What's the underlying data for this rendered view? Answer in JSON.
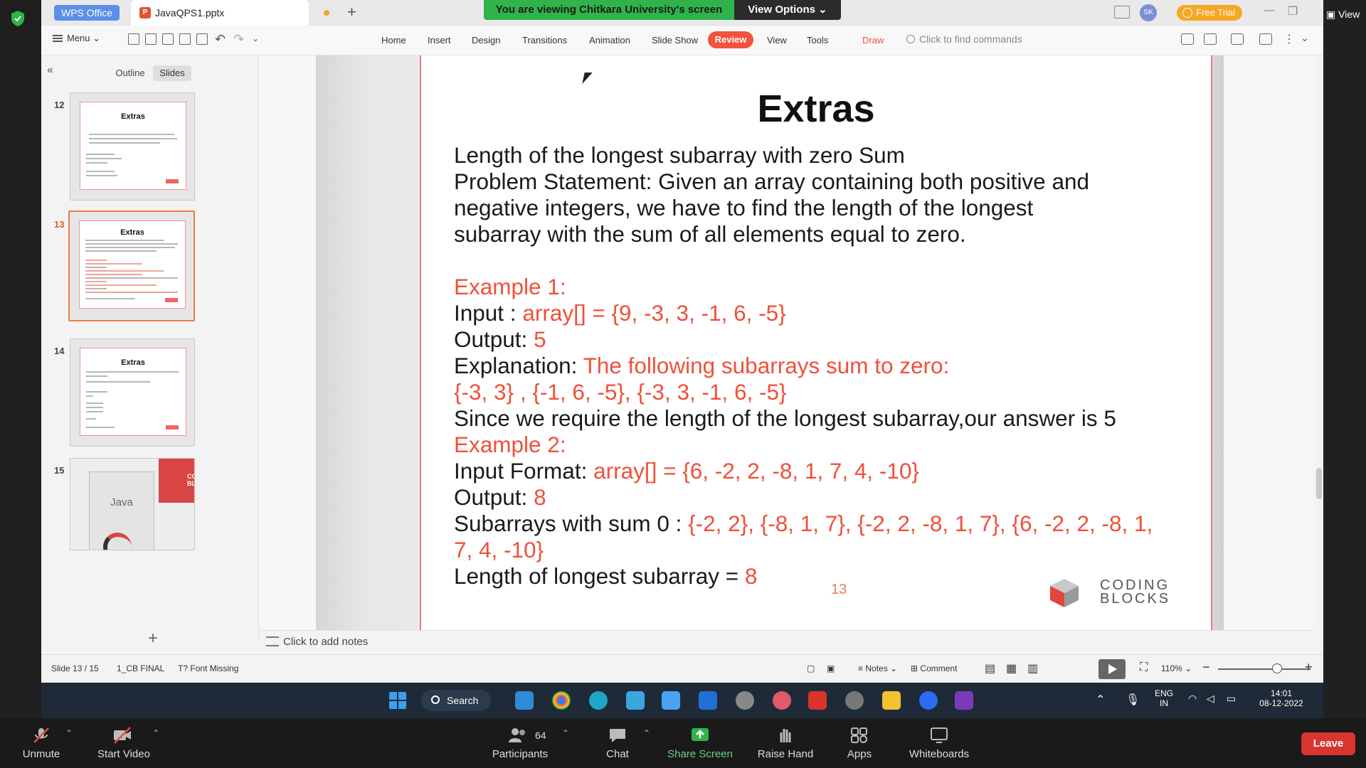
{
  "titlebar": {
    "app_tab": "WPS Office",
    "file_tab": "JavaQPS1.pptx",
    "share_banner": "You are viewing Chitkara University's screen",
    "view_options": "View Options",
    "avatar": "SK",
    "free_trial": "Free Trial",
    "view_right": "View"
  },
  "menubar": {
    "menu": "Menu",
    "tabs": [
      "Home",
      "Insert",
      "Design",
      "Transitions",
      "Animation",
      "Slide Show",
      "Review",
      "View",
      "Tools",
      "Draw"
    ],
    "search_placeholder": "Click to find commands",
    "active_tab": "Review"
  },
  "leftpanel": {
    "tabs": [
      "Outline",
      "Slides"
    ],
    "active_tab": "Slides",
    "thumbnails": [
      {
        "num": "12",
        "title": "Extras"
      },
      {
        "num": "13",
        "title": "Extras"
      },
      {
        "num": "14",
        "title": "Extras"
      },
      {
        "num": "15",
        "title": "Java",
        "logo": "CODING BLOCKS"
      }
    ],
    "active_slide": "13"
  },
  "slide": {
    "title": "Extras",
    "lines": {
      "l1": "Length of the longest subarray with zero Sum",
      "l2": "Problem Statement: Given an array containing both positive and",
      "l3": "negative integers, we have to find the length of the longest",
      "l4": "subarray with the sum of all elements equal to zero.",
      "ex1": "Example 1:",
      "input_label": "Input : ",
      "input_val": "array[] = {9, -3, 3, -1, 6, -5}",
      "output_label": "Output: ",
      "output_val": "5",
      "expl_label": "Explanation: ",
      "expl_val": "The following subarrays sum to zero:",
      "subarrays1": "{-3, 3} , {-1, 6, -5}, {-3, 3, -1, 6, -5}",
      "since": "Since we require the length of the longest subarray,our answer is 5",
      "ex2": "Example 2:",
      "input2_label": "Input Format: ",
      "input2_val": "array[] = {6, -2, 2, -8, 1, 7, 4, -10}",
      "output2_label": "Output: ",
      "output2_val": "8",
      "sub2_label": "Subarrays with sum 0 : ",
      "sub2_val_a": "{-2, 2}, {-8, 1, 7}, {-2, 2, -8, 1, 7}, {6, -2, 2, -8, 1,",
      "sub2_val_b": "7, 4, -10}",
      "len_label": "Length of longest subarray = ",
      "len_val": "8"
    },
    "page_number": "13",
    "logo_line1": "CODING",
    "logo_line2": "BLOCKS"
  },
  "notes_placeholder": "Click to add notes",
  "statusbar": {
    "slide_info": "Slide 13 / 15",
    "theme": "1_CB FINAL",
    "font_missing": "Font Missing",
    "notes": "Notes",
    "comment": "Comment",
    "zoom": "110%"
  },
  "taskbar": {
    "search": "Search",
    "lang1": "ENG",
    "lang2": "IN",
    "time": "14:01",
    "date": "08-12-2022"
  },
  "zoom_controls": {
    "unmute": "Unmute",
    "start_video": "Start Video",
    "participants": "Participants",
    "participants_count": "64",
    "chat": "Chat",
    "share_screen": "Share Screen",
    "raise_hand": "Raise Hand",
    "apps": "Apps",
    "whiteboards": "Whiteboards",
    "leave": "Leave"
  },
  "colors": {
    "accent": "#f2533a",
    "banner_green": "#2fb34a",
    "slide_red": "#f0503a",
    "leave_red": "#d9352e"
  }
}
